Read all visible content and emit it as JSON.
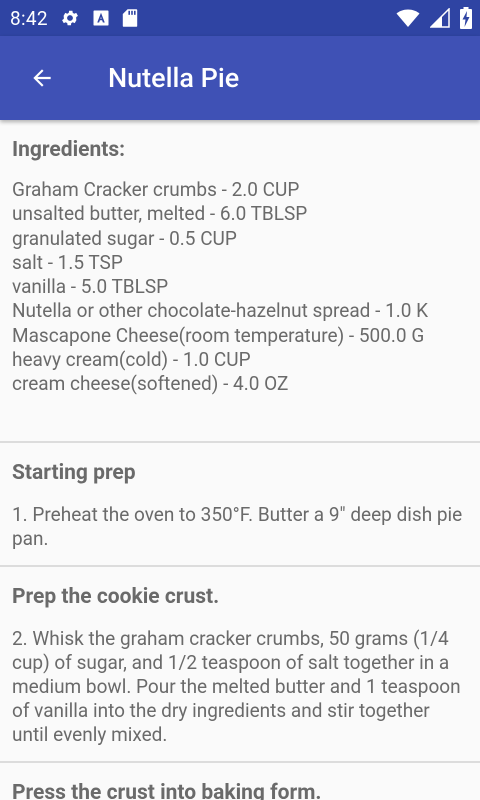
{
  "status_bar": {
    "time": "8:42",
    "icons_left": [
      "gear-icon",
      "font-a-icon",
      "sd-card-icon"
    ],
    "icons_right": [
      "wifi-icon",
      "signal-icon",
      "battery-charging-icon"
    ]
  },
  "app_bar": {
    "title": "Nutella Pie",
    "back_icon": "arrow-left-icon",
    "color": "#3f51b5",
    "status_color": "#2f44a3"
  },
  "ingredients": {
    "heading": "Ingredients:",
    "items": [
      "Graham Cracker crumbs - 2.0 CUP",
      "unsalted butter, melted - 6.0 TBLSP",
      "granulated sugar - 0.5 CUP",
      "salt - 1.5 TSP",
      "vanilla - 5.0 TBLSP",
      "Nutella or other chocolate-hazelnut spread - 1.0 K",
      "Mascapone Cheese(room temperature) - 500.0 G",
      "heavy cream(cold) - 1.0 CUP",
      "cream cheese(softened) - 4.0 OZ"
    ]
  },
  "steps": [
    {
      "heading": "Starting prep",
      "text": "1. Preheat the oven to 350°F. Butter a 9\" deep dish pie pan."
    },
    {
      "heading": "Prep the cookie crust.",
      "text": "2. Whisk the graham cracker crumbs, 50 grams (1/4 cup) of sugar, and 1/2 teaspoon of salt together in a medium bowl. Pour the melted butter and 1 teaspoon of vanilla into the dry ingredients and stir together until evenly mixed."
    },
    {
      "heading": "Press the crust into baking form.",
      "text": ""
    }
  ]
}
